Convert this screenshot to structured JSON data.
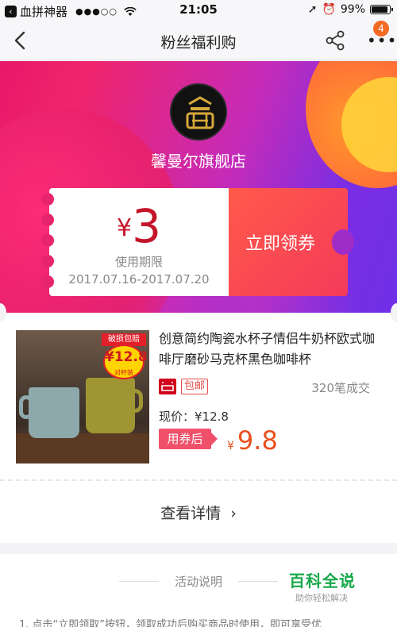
{
  "status_bar": {
    "app_back_label": "血拼神器",
    "time": "21:05",
    "battery": "99%"
  },
  "navbar": {
    "title": "粉丝福利购",
    "badge_count": "4"
  },
  "shop": {
    "name": "馨曼尔旗舰店"
  },
  "coupon": {
    "currency": "¥",
    "amount": "3",
    "period_label": "使用期限",
    "period": "2017.07.16-2017.07.20",
    "claim_label": "立即领券"
  },
  "product": {
    "title": "创意简约陶瓷水杯子情侣牛奶杯欧式咖啡厅磨砂马克杯黑色咖啡杯",
    "image_badge_top": "破损包赔",
    "image_badge_price": "¥12.8",
    "image_badge_sub": "对杯装",
    "free_shipping": "包邮",
    "sold": "320笔成交",
    "current_price_label": "现价：¥12.8",
    "after_coupon_label": "用券后",
    "final_currency": "¥",
    "final_price": "9.8",
    "detail_link": "查看详情"
  },
  "activity": {
    "title": "活动说明",
    "text": "1. 点击“立即领取”按钮，领取成功后购买商品时使用，即可享受优"
  },
  "watermark": {
    "title": "百科全说",
    "sub": "助你轻松解决"
  },
  "colors": {
    "accent": "#c4152a",
    "price": "#e8521f",
    "coupon_button": "#f43a5a"
  }
}
